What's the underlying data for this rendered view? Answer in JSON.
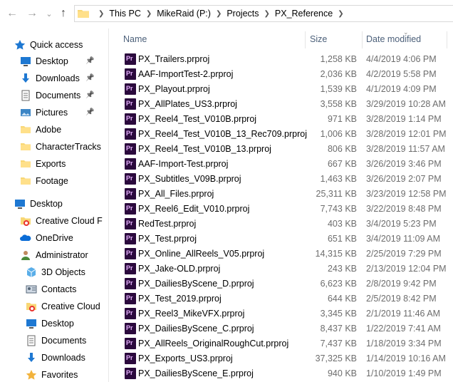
{
  "address": {
    "crumbs": [
      "This PC",
      "MikeRaid (P:)",
      "Projects",
      "PX_Reference"
    ]
  },
  "nav": {
    "quick_access": "Quick access",
    "qa_items": [
      {
        "label": "Desktop",
        "icon": "desktop-icon",
        "pinned": true
      },
      {
        "label": "Downloads",
        "icon": "downloads-icon",
        "pinned": true
      },
      {
        "label": "Documents",
        "icon": "documents-icon",
        "pinned": true
      },
      {
        "label": "Pictures",
        "icon": "pictures-icon",
        "pinned": true
      },
      {
        "label": "Adobe",
        "icon": "folder-icon",
        "pinned": false
      },
      {
        "label": "CharacterTracks",
        "icon": "folder-icon",
        "pinned": false
      },
      {
        "label": "Exports",
        "icon": "folder-icon",
        "pinned": false
      },
      {
        "label": "Footage",
        "icon": "folder-icon",
        "pinned": false
      }
    ],
    "desktop": "Desktop",
    "desktop_items": [
      {
        "label": "Creative Cloud F",
        "icon": "creative-cloud-icon"
      },
      {
        "label": "OneDrive",
        "icon": "onedrive-icon"
      },
      {
        "label": "Administrator",
        "icon": "user-icon"
      }
    ],
    "user_items": [
      {
        "label": "3D Objects",
        "icon": "3d-objects-icon"
      },
      {
        "label": "Contacts",
        "icon": "contacts-icon"
      },
      {
        "label": "Creative Cloud",
        "icon": "creative-cloud-icon"
      },
      {
        "label": "Desktop",
        "icon": "desktop-icon"
      },
      {
        "label": "Documents",
        "icon": "documents-icon"
      },
      {
        "label": "Downloads",
        "icon": "downloads-icon"
      },
      {
        "label": "Favorites",
        "icon": "favorites-icon"
      }
    ]
  },
  "columns": {
    "name": "Name",
    "size": "Size",
    "date": "Date modified",
    "sort": "date-descending"
  },
  "files": [
    {
      "name": "PX_Trailers.prproj",
      "size": "1,258 KB",
      "date": "4/4/2019 4:06 PM"
    },
    {
      "name": "AAF-ImportTest-2.prproj",
      "size": "2,036 KB",
      "date": "4/2/2019 5:58 PM"
    },
    {
      "name": "PX_Playout.prproj",
      "size": "1,539 KB",
      "date": "4/1/2019 4:09 PM"
    },
    {
      "name": "PX_AllPlates_US3.prproj",
      "size": "3,558 KB",
      "date": "3/29/2019 10:28 AM"
    },
    {
      "name": "PX_Reel4_Test_V010B.prproj",
      "size": "971 KB",
      "date": "3/28/2019 1:14 PM"
    },
    {
      "name": "PX_Reel4_Test_V010B_13_Rec709.prproj",
      "size": "1,006 KB",
      "date": "3/28/2019 12:01 PM"
    },
    {
      "name": "PX_Reel4_Test_V010B_13.prproj",
      "size": "806 KB",
      "date": "3/28/2019 11:57 AM"
    },
    {
      "name": "AAF-Import-Test.prproj",
      "size": "667 KB",
      "date": "3/26/2019 3:46 PM"
    },
    {
      "name": "PX_Subtitles_V09B.prproj",
      "size": "1,463 KB",
      "date": "3/26/2019 2:07 PM"
    },
    {
      "name": "PX_All_Files.prproj",
      "size": "25,311 KB",
      "date": "3/23/2019 12:58 PM"
    },
    {
      "name": "PX_Reel6_Edit_V010.prproj",
      "size": "7,743 KB",
      "date": "3/22/2019 8:48 PM"
    },
    {
      "name": "RedTest.prproj",
      "size": "403 KB",
      "date": "3/4/2019 5:23 PM"
    },
    {
      "name": "PX_Test.prproj",
      "size": "651 KB",
      "date": "3/4/2019 11:09 AM"
    },
    {
      "name": "PX_Online_AllReels_V05.prproj",
      "size": "14,315 KB",
      "date": "2/25/2019 7:29 PM"
    },
    {
      "name": "PX_Jake-OLD.prproj",
      "size": "243 KB",
      "date": "2/13/2019 12:04 PM"
    },
    {
      "name": "PX_DailiesByScene_D.prproj",
      "size": "6,623 KB",
      "date": "2/8/2019 9:42 PM"
    },
    {
      "name": "PX_Test_2019.prproj",
      "size": "644 KB",
      "date": "2/5/2019 8:42 PM"
    },
    {
      "name": "PX_Reel3_MikeVFX.prproj",
      "size": "3,345 KB",
      "date": "2/1/2019 11:46 AM"
    },
    {
      "name": "PX_DailiesByScene_C.prproj",
      "size": "8,437 KB",
      "date": "1/22/2019 7:41 AM"
    },
    {
      "name": "PX_AllReels_OriginalRoughCut.prproj",
      "size": "7,437 KB",
      "date": "1/18/2019 3:34 PM"
    },
    {
      "name": "PX_Exports_US3.prproj",
      "size": "37,325 KB",
      "date": "1/14/2019 10:16 AM"
    },
    {
      "name": "PX_DailiesByScene_E.prproj",
      "size": "940 KB",
      "date": "1/10/2019 1:49 PM"
    }
  ],
  "colors": {
    "accent": "#0078d7",
    "header_text": "#4c607a",
    "premiere_icon": "#2b0a3d"
  }
}
